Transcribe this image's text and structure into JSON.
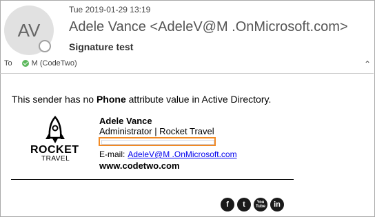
{
  "header": {
    "avatar_initials": "AV",
    "date": "Tue 2019-01-29 13:19",
    "sender": "Adele Vance <AdeleV@M      .OnMicrosoft.com>",
    "subject": "Signature test",
    "to_label": "To",
    "recipient": "M (CodeTwo)"
  },
  "body": {
    "line_before": "This sender has no ",
    "line_bold": "Phone",
    "line_after": " attribute value in Active Directory."
  },
  "signature": {
    "logo_word": "ROCKET",
    "logo_sub": "TRAVEL",
    "name": "Adele Vance",
    "title": "Administrator | Rocket Travel",
    "email_label": "E-mail:",
    "email": "AdeleV@M     .OnMicrosoft.com",
    "website": "www.codetwo.com",
    "social": [
      "f",
      "t",
      "You\nTube",
      "in"
    ]
  },
  "colors": {
    "highlight": "#f28a24",
    "link": "#0000ee",
    "presence_ok": "#5cb85c"
  }
}
